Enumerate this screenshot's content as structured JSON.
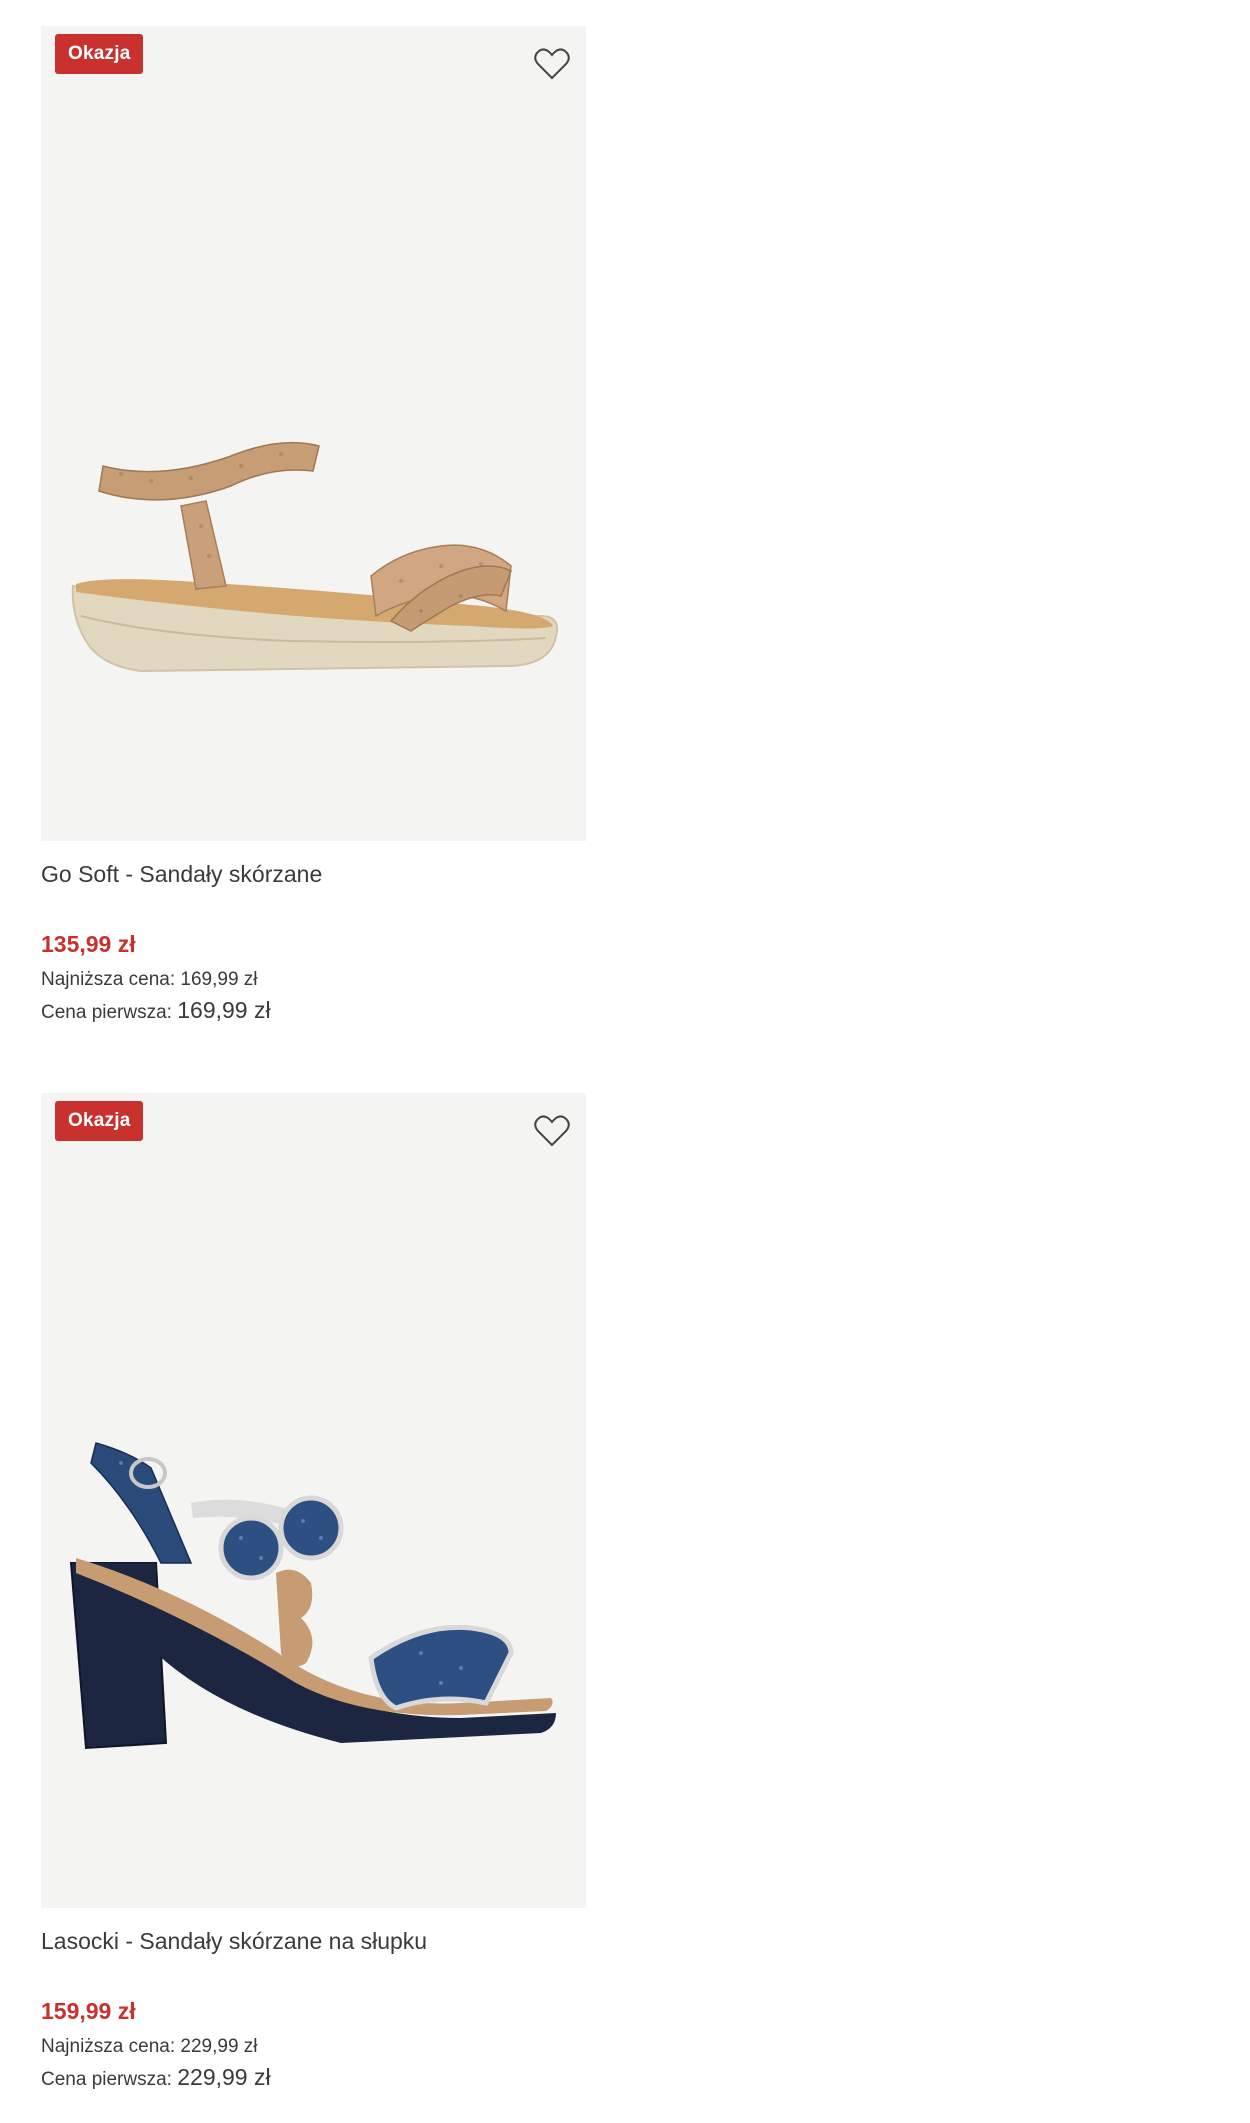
{
  "products": [
    {
      "badge": "Okazja",
      "title": "Go Soft - Sandały skórzane",
      "price": "135,99 zł",
      "lowest_label": "Najniższa cena:",
      "lowest_value": "169,99 zł",
      "first_label": "Cena pierwsza:",
      "first_value": "169,99 zł",
      "wishlist_icon": "heart-outline-icon"
    },
    {
      "badge": "Okazja",
      "title": "Lasocki - Sandały skórzane na słupku",
      "price": "159,99 zł",
      "lowest_label": "Najniższa cena:",
      "lowest_value": "229,99 zł",
      "first_label": "Cena pierwsza:",
      "first_value": "229,99 zł",
      "wishlist_icon": "heart-outline-icon"
    }
  ],
  "colors": {
    "accent": "#c8312e",
    "image_bg": "#f4f4f2",
    "text": "#3a3a3a"
  }
}
